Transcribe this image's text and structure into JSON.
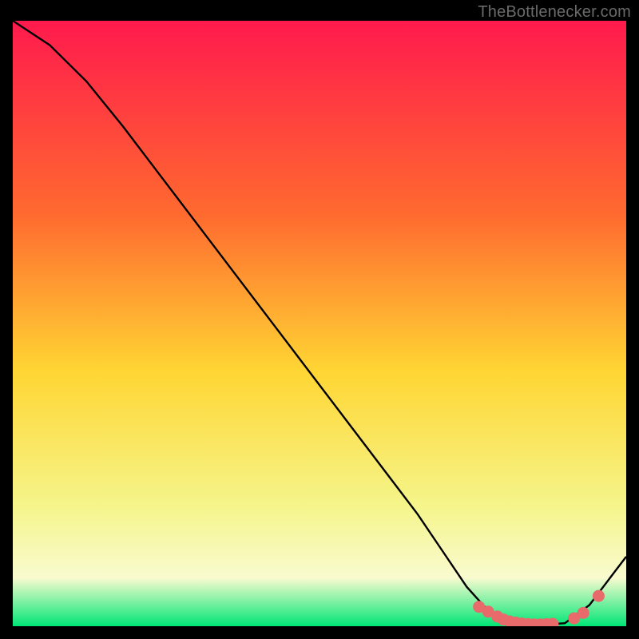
{
  "watermark": "TheBottlenecker.com",
  "colors": {
    "background": "#000000",
    "watermark_text": "#6a6a6a",
    "gradient_top": "#ff1a4d",
    "gradient_mid_upper": "#ff6a2f",
    "gradient_mid": "#ffd633",
    "gradient_mid_lower": "#f5f58a",
    "gradient_lower": "#f9fbcf",
    "gradient_bottom": "#00e676",
    "line": "#000000",
    "marker_fill": "#e86a6a",
    "marker_stroke": "#e86a6a"
  },
  "chart_data": {
    "type": "line",
    "title": "",
    "xlabel": "",
    "ylabel": "",
    "xlim": [
      0,
      100
    ],
    "ylim": [
      0,
      100
    ],
    "series": [
      {
        "name": "curve",
        "x": [
          0,
          6,
          12,
          18,
          24,
          30,
          36,
          42,
          48,
          54,
          60,
          66,
          70,
          74,
          78,
          82,
          86,
          90,
          94,
          100
        ],
        "y": [
          100,
          96,
          90,
          82.5,
          74.5,
          66.5,
          58.5,
          50.5,
          42.5,
          34.5,
          26.5,
          18.5,
          12.5,
          6.5,
          2.0,
          0.5,
          0.2,
          0.5,
          3.5,
          11.5
        ]
      }
    ],
    "markers": {
      "name": "highlight-points",
      "x": [
        76,
        77.5,
        79,
        80,
        81,
        82,
        83,
        84,
        85,
        86,
        87,
        88,
        91.5,
        93,
        95.5
      ],
      "y": [
        3.2,
        2.4,
        1.6,
        1.1,
        0.8,
        0.6,
        0.45,
        0.35,
        0.3,
        0.3,
        0.35,
        0.4,
        1.3,
        2.2,
        5.0
      ]
    }
  }
}
